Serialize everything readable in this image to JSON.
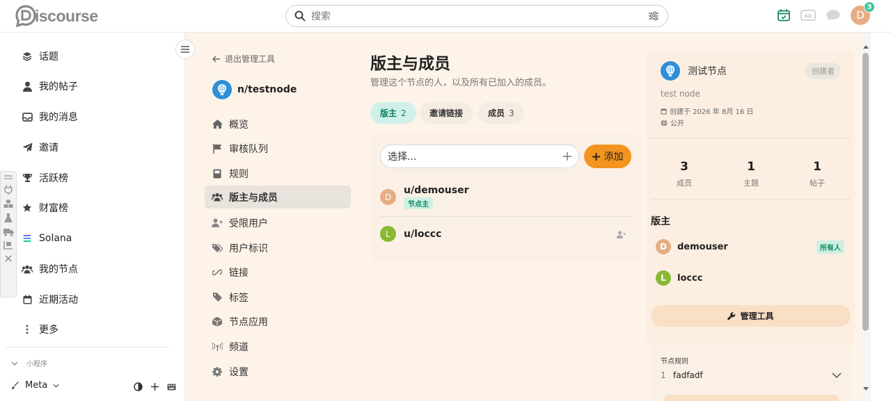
{
  "header": {
    "logo_text": "iscourse",
    "search_placeholder": "搜索",
    "notification_count": "3",
    "avatar_letter": "D"
  },
  "sidebar": {
    "items": [
      {
        "label": "话题",
        "icon": "layers-icon"
      },
      {
        "label": "我的帖子",
        "icon": "user-icon"
      },
      {
        "label": "我的消息",
        "icon": "inbox-icon"
      },
      {
        "label": "邀请",
        "icon": "paper-plane-icon"
      },
      {
        "label": "活跃榜",
        "icon": "trophy-icon"
      },
      {
        "label": "财富榜",
        "icon": "star-icon"
      },
      {
        "label": "Solana",
        "icon": "solana-icon"
      },
      {
        "label": "我的节点",
        "icon": "users-icon"
      },
      {
        "label": "近期活动",
        "icon": "calendar-icon"
      },
      {
        "label": "更多",
        "icon": "more-vertical-icon"
      }
    ],
    "section_label": "小程序",
    "meta_label": "Meta"
  },
  "admin_nav": {
    "back_label": "退出管理工具",
    "node_name": "n/testnode",
    "items": [
      {
        "label": "概览",
        "icon": "home-icon"
      },
      {
        "label": "审核队列",
        "icon": "flag-icon"
      },
      {
        "label": "规则",
        "icon": "book-icon"
      },
      {
        "label": "版主与成员",
        "icon": "users-icon"
      },
      {
        "label": "受限用户",
        "icon": "user-x-icon"
      },
      {
        "label": "用户标识",
        "icon": "tags-icon"
      },
      {
        "label": "链接",
        "icon": "link-icon"
      },
      {
        "label": "标签",
        "icon": "tag-icon"
      },
      {
        "label": "节点应用",
        "icon": "cube-icon"
      },
      {
        "label": "频道",
        "icon": "broadcast-icon"
      },
      {
        "label": "设置",
        "icon": "gear-icon"
      }
    ]
  },
  "main": {
    "title": "版主与成员",
    "subtitle": "管理这个节点的人，以及所有已加入的成员。",
    "tabs": [
      {
        "label": "版主",
        "count": "2"
      },
      {
        "label": "邀请链接",
        "count": ""
      },
      {
        "label": "成员",
        "count": "3"
      }
    ],
    "select_placeholder": "选择...",
    "add_label": "添加",
    "members": [
      {
        "letter": "D",
        "name": "u/demouser",
        "badge": "节点主",
        "color": "#e6ad84"
      },
      {
        "letter": "L",
        "name": "u/loccc",
        "badge": "",
        "color": "#8ab833"
      }
    ]
  },
  "node_card": {
    "name": "测试节点",
    "creator_label": "创建者",
    "description": "test node",
    "created": "创建于 2026 年 8月 16 日",
    "visibility": "公开",
    "stats": [
      {
        "num": "3",
        "label": "成员"
      },
      {
        "num": "1",
        "label": "主题"
      },
      {
        "num": "1",
        "label": "帖子"
      }
    ],
    "moderators_title": "版主",
    "moderators": [
      {
        "letter": "D",
        "name": "demouser",
        "badge": "所有人",
        "color": "#e6ad84"
      },
      {
        "letter": "L",
        "name": "loccc",
        "badge": "",
        "color": "#8ab833"
      }
    ],
    "tools_label": "管理工具",
    "rules_title": "节点规则",
    "rules": [
      {
        "index": "1",
        "text": "fadfadf"
      }
    ]
  }
}
